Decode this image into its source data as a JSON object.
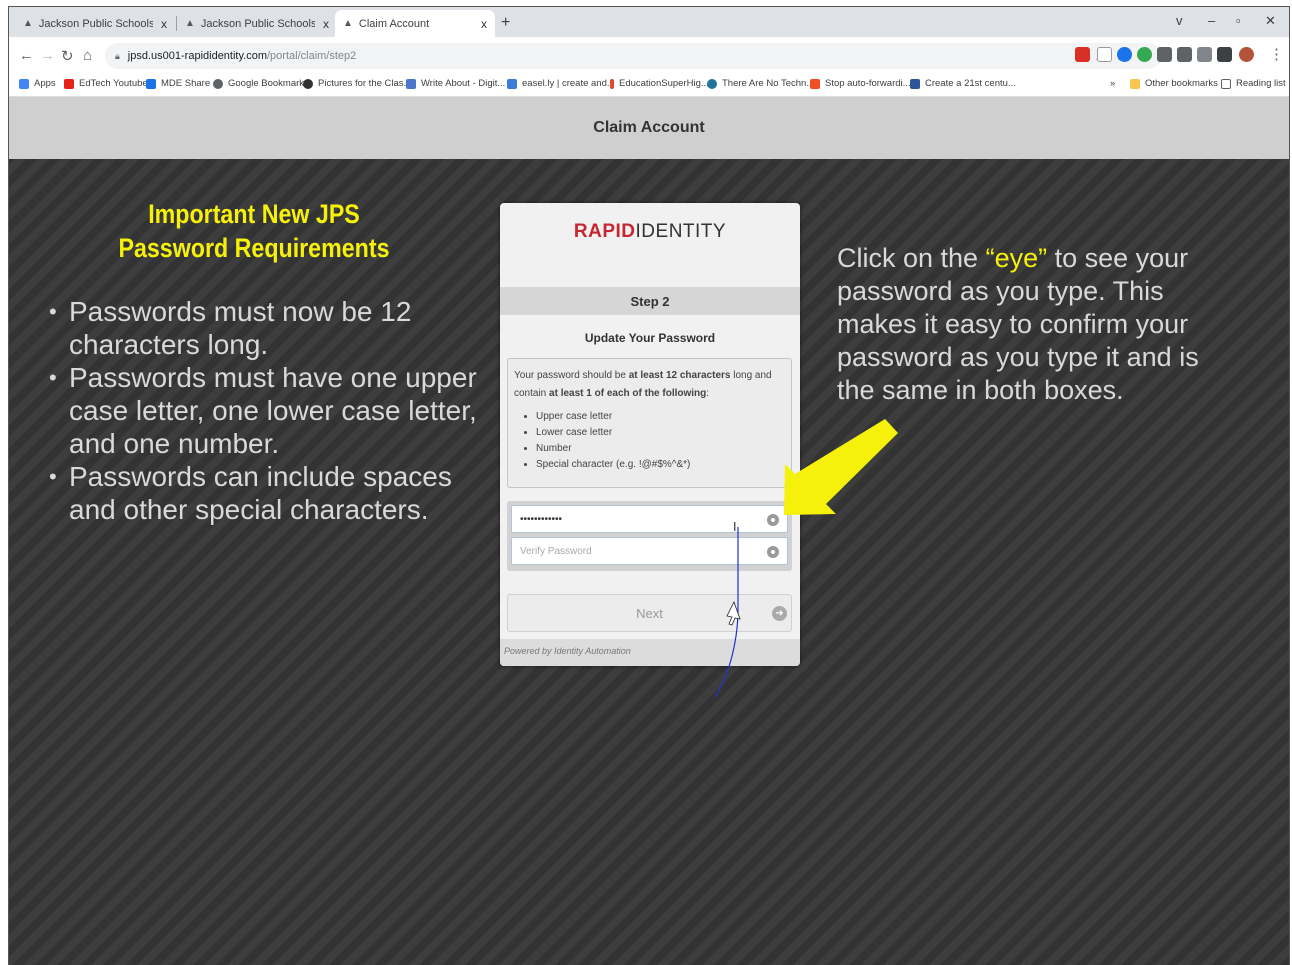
{
  "browser": {
    "tabs": [
      {
        "title": "Jackson Public Schools Portal",
        "active": false
      },
      {
        "title": "Jackson Public Schools Portal",
        "active": false
      },
      {
        "title": "Claim Account",
        "active": true
      }
    ],
    "tab_close_glyph": "x",
    "new_tab_glyph": "+",
    "window_controls": [
      "v",
      "–",
      "▫",
      "✕"
    ],
    "url_host": "jpsd.us001-rapididentity.com",
    "url_path": "/portal/claim/step2",
    "bookmarks": [
      {
        "label": "Apps",
        "color": "#4285f4"
      },
      {
        "label": "EdTech Youtube",
        "color": "#e62117"
      },
      {
        "label": "MDE Share",
        "color": "#1a73e8"
      },
      {
        "label": "Google Bookmark",
        "color": "#5f6368"
      },
      {
        "label": "Pictures for the Clas...",
        "color": "#333333"
      },
      {
        "label": "Write About - Digit...",
        "color": "#4a76c9"
      },
      {
        "label": "easel.ly | create and...",
        "color": "#3b7dd8"
      },
      {
        "label": "EducationSuperHig...",
        "color": "#e2462f"
      },
      {
        "label": "There Are No Techn...",
        "color": "#21759b"
      },
      {
        "label": "Stop auto-forwardi...",
        "color": "#f25022"
      },
      {
        "label": "Create a 21st centu...",
        "color": "#2b579a"
      }
    ],
    "bookmarks_overflow": "»",
    "other_bookmarks": "Other bookmarks",
    "reading_list": "Reading list"
  },
  "page": {
    "header_title": "Claim Account",
    "left_title": "Important New JPS Password Requirements",
    "left_bullets": [
      "Passwords must now be 12 characters long.",
      "Passwords must have one upper case letter, one lower case letter, and one number.",
      "Passwords can include spaces and other special characters."
    ],
    "right_text_before": "Click on the ",
    "right_text_highlight": "“eye”",
    "right_text_after": " to see your password as you type.  This makes it easy to confirm your password as you type it and is the same in both boxes.",
    "highlight_color": "#f5f10a"
  },
  "card": {
    "logo_rapid": "RAPID",
    "logo_identity": "IDENTITY",
    "step_label": "Step 2",
    "update_title": "Update Your Password",
    "req_intro_1": "Your password should be ",
    "req_intro_bold": "at least 12 characters",
    "req_intro_2": " long and contain ",
    "req_intro_bold2": "at least 1 of each of the following",
    "req_intro_3": ":",
    "req_items": [
      "Upper case letter",
      "Lower case letter",
      "Number",
      "Special character (e.g. !@#$%^&*)"
    ],
    "password_value": "••••••••••••",
    "verify_placeholder": "Verify Password",
    "next_label": "Next",
    "powered_by": "Powered by Identity Automation"
  }
}
